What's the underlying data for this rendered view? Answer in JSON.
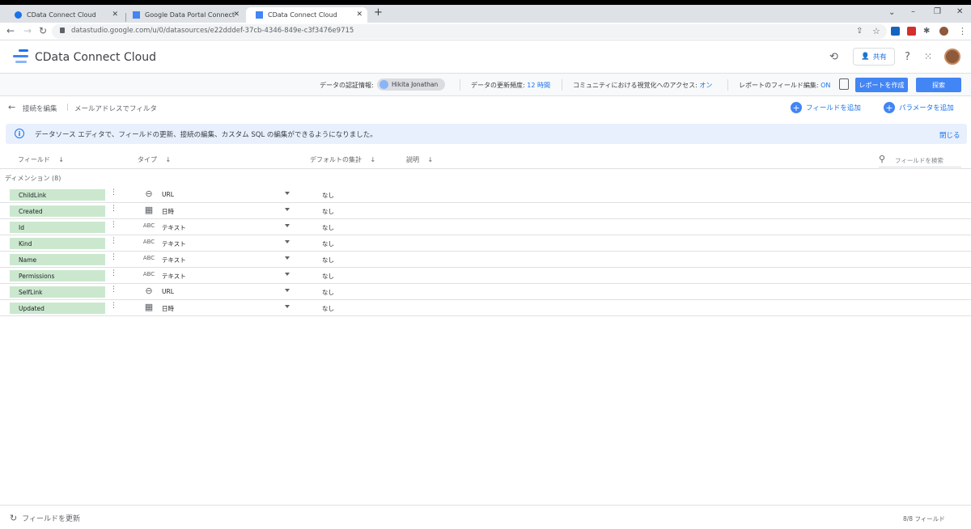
{
  "browser": {
    "tabs": [
      {
        "title": "CData Connect Cloud",
        "active": false
      },
      {
        "title": "Google Data Portal Connect to D",
        "active": false
      },
      {
        "title": "CData Connect Cloud",
        "active": true
      }
    ],
    "url": "datastudio.google.com/u/0/datasources/e22dddef-37cb-4346-849e-c3f3476e9715"
  },
  "app": {
    "title": "CData Connect Cloud",
    "share_label": "共有"
  },
  "toolbar": {
    "credentials_label": "データの認証情報:",
    "credentials_user": "Hikita Jonathan",
    "freshness_label": "データの更新頻度:",
    "freshness_value": "12 時間",
    "community_label": "コミュニティにおける視覚化へのアクセス:",
    "community_value": "オン",
    "field_edit_label": "レポートのフィールド編集:",
    "field_edit_value": "ON",
    "create_report": "レポートを作成",
    "explore": "探索"
  },
  "subheader": {
    "edit_connection": "接続を編集",
    "filter_label": "メールアドレスでフィルタ",
    "add_field": "フィールドを追加",
    "add_parameter": "パラメータを追加"
  },
  "banner": {
    "text": "データソース エディタで、フィールドの更新、接続の編集、カスタム SQL の編集ができるようになりました。",
    "close": "閉じる"
  },
  "columns": {
    "field": "フィールド",
    "type": "タイプ",
    "default_aggregation": "デフォルトの集計",
    "description": "説明",
    "search_placeholder": "フィールドを検索"
  },
  "dimension_label": "ディメンション (8)",
  "fields": [
    {
      "name": "ChildLink",
      "type_icon": "link-icon",
      "type": "URL",
      "aggregation": "なし"
    },
    {
      "name": "Created",
      "type_icon": "calendar-icon",
      "type": "日時",
      "aggregation": "なし"
    },
    {
      "name": "Id",
      "type_icon": "abc-icon",
      "type": "テキスト",
      "aggregation": "なし"
    },
    {
      "name": "Kind",
      "type_icon": "abc-icon",
      "type": "テキスト",
      "aggregation": "なし"
    },
    {
      "name": "Name",
      "type_icon": "abc-icon",
      "type": "テキスト",
      "aggregation": "なし"
    },
    {
      "name": "Permissions",
      "type_icon": "abc-icon",
      "type": "テキスト",
      "aggregation": "なし"
    },
    {
      "name": "SelfLink",
      "type_icon": "link-icon",
      "type": "URL",
      "aggregation": "なし"
    },
    {
      "name": "Updated",
      "type_icon": "calendar-icon",
      "type": "日時",
      "aggregation": "なし"
    }
  ],
  "footer": {
    "refresh": "フィールドを更新",
    "count": "8/8 フィールド"
  },
  "colors": {
    "accent": "#4285f4",
    "field_chip": "#cbe8cf",
    "banner_bg": "#e8f0fe"
  }
}
